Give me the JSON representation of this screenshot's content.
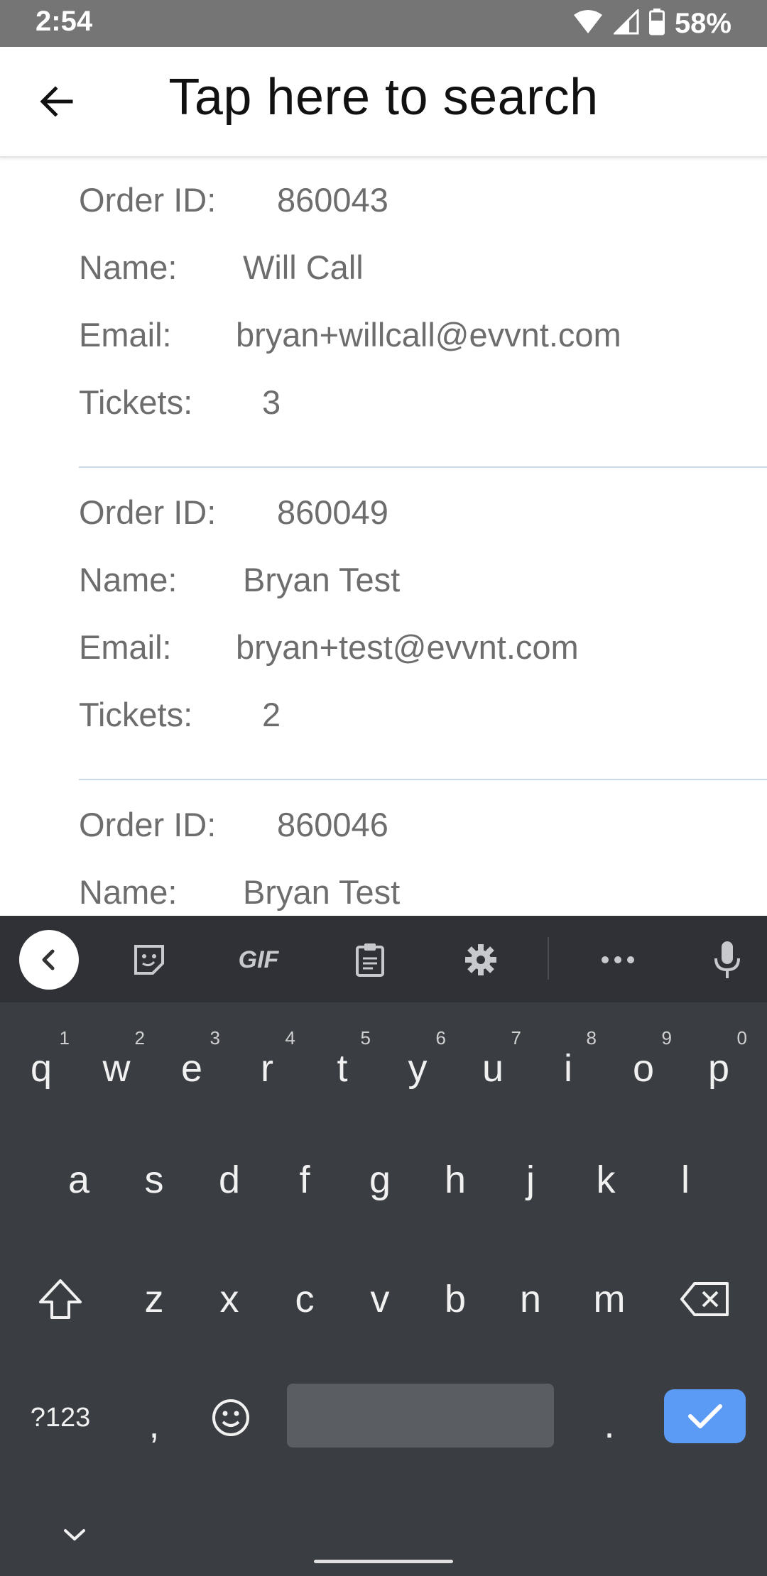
{
  "status_bar": {
    "time": "2:54",
    "battery_percent": "58%"
  },
  "header": {
    "search_title": "Tap here to search"
  },
  "labels": {
    "order_id": "Order ID:",
    "name": "Name:",
    "email": "Email:",
    "tickets": "Tickets:"
  },
  "orders": [
    {
      "order_id": "860043",
      "name": "Will Call",
      "email": "bryan+willcall@evvnt.com",
      "tickets": "3"
    },
    {
      "order_id": "860049",
      "name": "Bryan Test",
      "email": "bryan+test@evvnt.com",
      "tickets": "2"
    },
    {
      "order_id": "860046",
      "name": "Bryan Test"
    }
  ],
  "keyboard": {
    "toolbar_icons": [
      "back-icon",
      "sticker-icon",
      "gif-icon",
      "clipboard-icon",
      "gear-icon",
      "more-icon",
      "microphone-icon"
    ],
    "gif_label": "GIF",
    "row1": [
      {
        "k": "q",
        "h": "1"
      },
      {
        "k": "w",
        "h": "2"
      },
      {
        "k": "e",
        "h": "3"
      },
      {
        "k": "r",
        "h": "4"
      },
      {
        "k": "t",
        "h": "5"
      },
      {
        "k": "y",
        "h": "6"
      },
      {
        "k": "u",
        "h": "7"
      },
      {
        "k": "i",
        "h": "8"
      },
      {
        "k": "o",
        "h": "9"
      },
      {
        "k": "p",
        "h": "0"
      }
    ],
    "row2": [
      "a",
      "s",
      "d",
      "f",
      "g",
      "h",
      "j",
      "k",
      "l"
    ],
    "row3": [
      "z",
      "x",
      "c",
      "v",
      "b",
      "n",
      "m"
    ],
    "symbols_label": "?123",
    "comma": ",",
    "period": "."
  },
  "colors": {
    "status_bar": "#757575",
    "keyboard_bg": "#3a3d42",
    "enter_key": "#5c9bf5"
  }
}
